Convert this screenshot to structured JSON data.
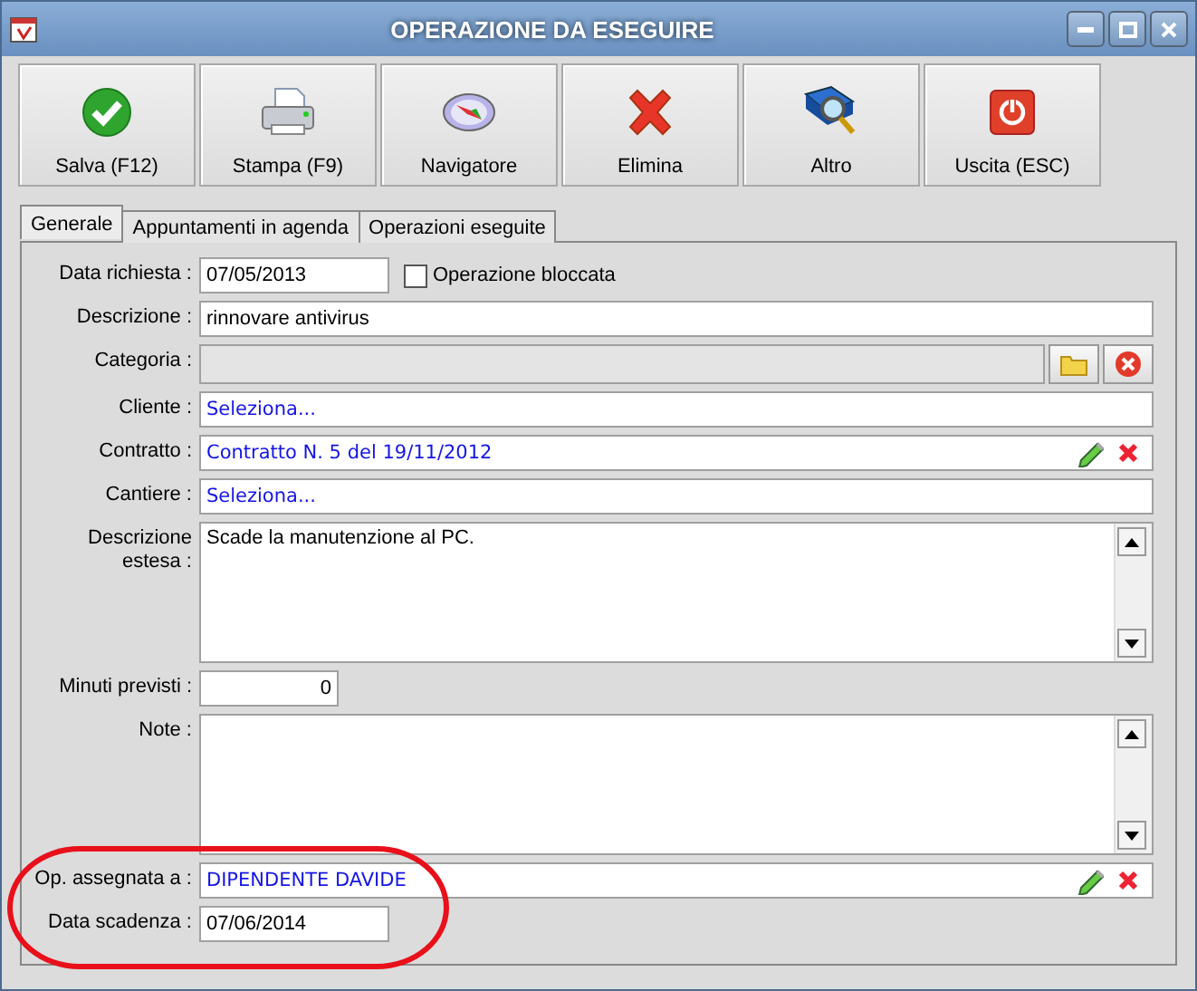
{
  "window": {
    "title": "OPERAZIONE DA ESEGUIRE"
  },
  "toolbar": [
    {
      "label": "Salva (F12)",
      "kind": "check"
    },
    {
      "label": "Stampa (F9)",
      "kind": "printer"
    },
    {
      "label": "Navigatore",
      "kind": "compass"
    },
    {
      "label": "Elimina",
      "kind": "cross"
    },
    {
      "label": "Altro",
      "kind": "book"
    },
    {
      "label": "Uscita (ESC)",
      "kind": "power"
    }
  ],
  "tabs": [
    {
      "label": "Generale",
      "selected": true
    },
    {
      "label": "Appuntamenti in agenda",
      "selected": false
    },
    {
      "label": "Operazioni eseguite",
      "selected": false
    }
  ],
  "fields": [
    {
      "kind": "date",
      "label": "Data richiesta :",
      "value": "07/05/2013",
      "checkbox": {
        "label": "Operazione bloccata",
        "checked": false
      }
    },
    {
      "kind": "text",
      "label": "Descrizione :",
      "value": "rinnovare antivirus"
    },
    {
      "kind": "category",
      "label": "Categoria :"
    },
    {
      "kind": "lookup",
      "label": "Cliente :",
      "value": "Seleziona...",
      "actions": false
    },
    {
      "kind": "lookup",
      "label": "Contratto :",
      "value": "Contratto N. 5 del 19/11/2012",
      "actions": true
    },
    {
      "kind": "lookup",
      "label": "Cantiere :",
      "value": "Seleziona...",
      "actions": false
    },
    {
      "kind": "memo",
      "label": "Descrizione estesa :",
      "value": "Scade la manutenzione al PC."
    },
    {
      "kind": "number",
      "label": "Minuti previsti :",
      "value": "0"
    },
    {
      "kind": "memo",
      "label": "Note :"
    },
    {
      "kind": "lookup",
      "label": "Op. assegnata a :",
      "value": "DIPENDENTE DAVIDE",
      "actions": true
    },
    {
      "kind": "date",
      "label": "Data scadenza :",
      "value": "07/06/2014"
    }
  ],
  "annotation": {
    "kind": "ellipse"
  }
}
